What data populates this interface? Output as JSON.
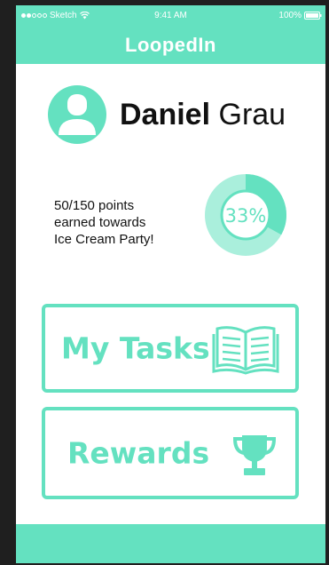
{
  "status_bar": {
    "carrier": "Sketch",
    "time": "9:41 AM",
    "battery": "100%"
  },
  "nav": {
    "title": "LoopedIn"
  },
  "profile": {
    "first_name": "Daniel",
    "last_name": "Grau",
    "avatar_icon": "user-avatar-icon"
  },
  "progress": {
    "lines": [
      "50/150 points",
      "earned towards",
      "Ice Cream Party!"
    ],
    "points_earned": 50,
    "points_goal": 150,
    "percent_label": "33%",
    "fraction": 0.33
  },
  "buttons": {
    "tasks_label": "My Tasks",
    "tasks_icon": "book-icon",
    "rewards_label": "Rewards",
    "rewards_icon": "trophy-icon"
  },
  "colors": {
    "accent": "#64e1c0",
    "background": "#ffffff",
    "text": "#111111",
    "frame": "#1f1f1f"
  }
}
